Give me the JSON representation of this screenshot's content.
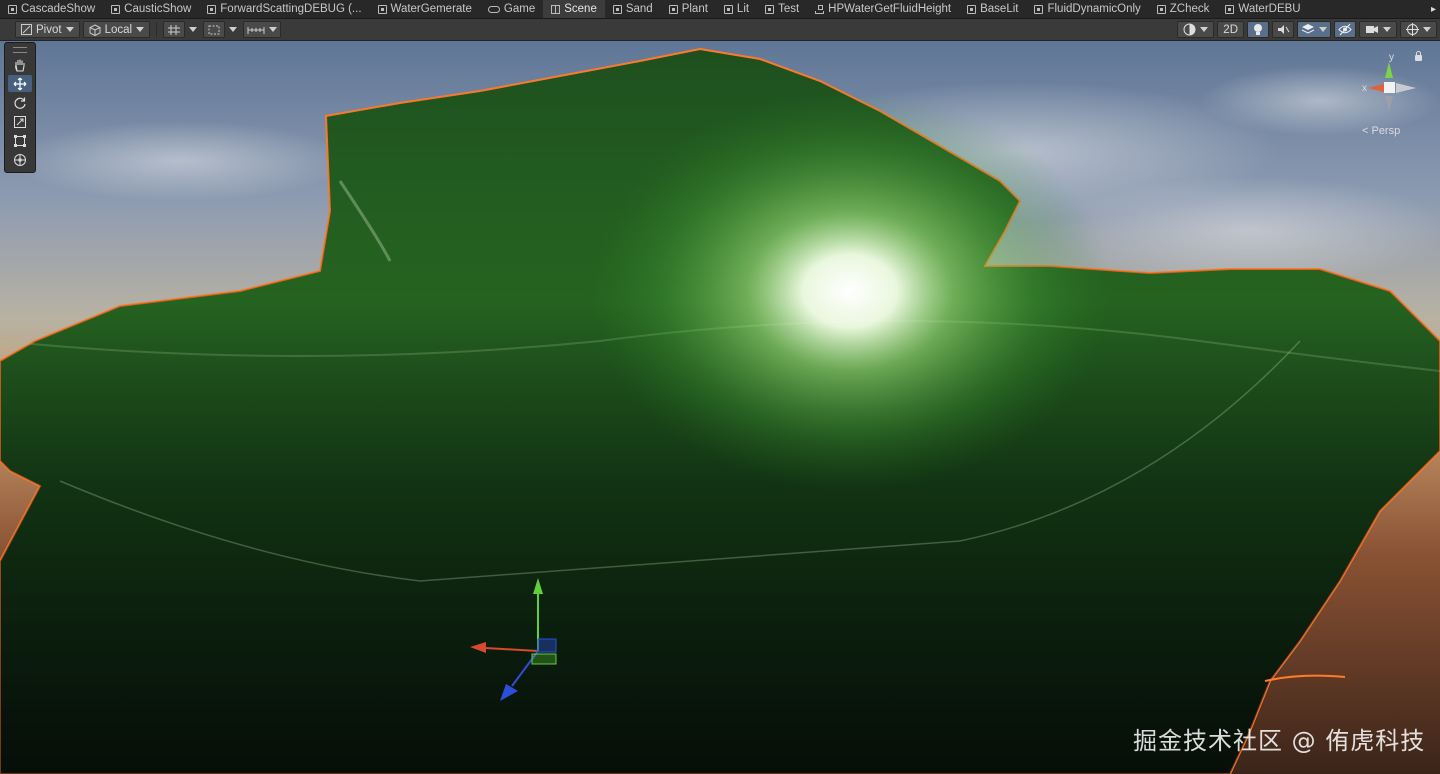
{
  "tabs": [
    {
      "label": "CascadeShow",
      "icon": "shader-icon"
    },
    {
      "label": "CausticShow",
      "icon": "shader-icon"
    },
    {
      "label": "ForwardScattingDEBUG (...",
      "icon": "shader-icon"
    },
    {
      "label": "WaterGemerate",
      "icon": "shader-icon"
    },
    {
      "label": "Game",
      "icon": "game-icon"
    },
    {
      "label": "Scene",
      "icon": "scene-icon"
    },
    {
      "label": "Sand",
      "icon": "shader-icon"
    },
    {
      "label": "Plant",
      "icon": "shader-icon"
    },
    {
      "label": "Lit",
      "icon": "shader-icon"
    },
    {
      "label": "Test",
      "icon": "shader-icon"
    },
    {
      "label": "HPWaterGetFluidHeight",
      "icon": "graph-icon"
    },
    {
      "label": "BaseLit",
      "icon": "shader-icon"
    },
    {
      "label": "FluidDynamicOnly",
      "icon": "shader-icon"
    },
    {
      "label": "ZCheck",
      "icon": "shader-icon"
    },
    {
      "label": "WaterDEBU",
      "icon": "shader-icon"
    }
  ],
  "active_tab": "Scene",
  "toolbar": {
    "pivot_label": "Pivot",
    "local_label": "Local",
    "mode_2d_label": "2D"
  },
  "tools": [
    "hand-tool-icon",
    "move-tool-icon",
    "rotate-tool-icon",
    "scale-tool-icon",
    "rect-tool-icon",
    "transform-tool-icon"
  ],
  "active_tool": "move-tool-icon",
  "gizmo": {
    "y_label": "y",
    "x_label": "x",
    "projection_label": "< Persp"
  },
  "watermark": "掘金技术社区 @ 侑虎科技",
  "colors": {
    "selection_outline": "#ff7a2a",
    "water_green": "#2f8a2a",
    "axis_x": "#d94a2a",
    "axis_y": "#5fcf3a",
    "axis_z": "#2a4fd9",
    "active_tool": "#46607f"
  }
}
